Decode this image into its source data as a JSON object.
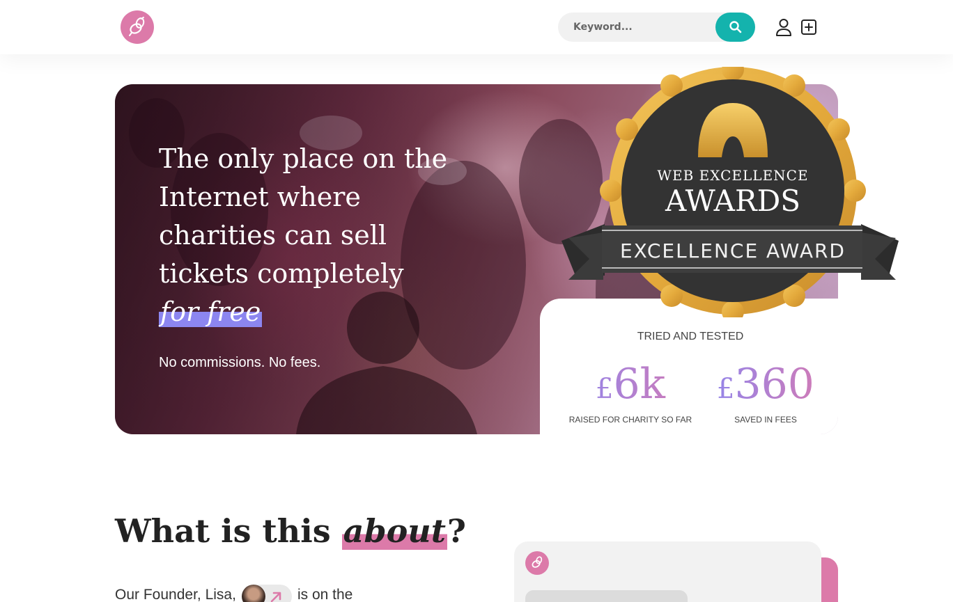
{
  "header": {
    "logo_icon": "bee-icon",
    "search_placeholder": "Keyword...",
    "search_icon": "search-icon",
    "account_icon": "user-icon",
    "add_icon": "plus-square-icon",
    "accent_color": "#14b3ad"
  },
  "hero": {
    "title_main": "The only place on the Internet where charities can sell tickets completely ",
    "title_highlight": "for free",
    "subtitle": "No commissions. No fees."
  },
  "award": {
    "line1": "WEB EXCELLENCE",
    "line2": "AWARDS",
    "ribbon": "EXCELLENCE AWARD"
  },
  "stats": {
    "heading": "TRIED AND TESTED",
    "items": [
      {
        "currency": "£",
        "value": "6k",
        "label": "RAISED FOR CHARITY SO FAR"
      },
      {
        "currency": "£",
        "value": "360",
        "label": "SAVED IN FEES"
      }
    ]
  },
  "about": {
    "title_before": "What is this ",
    "title_highlight": "about",
    "title_after": "?",
    "text_before": "Our Founder, Lisa,",
    "text_after": "is on the",
    "highlight_color": "#dc7aa9"
  }
}
